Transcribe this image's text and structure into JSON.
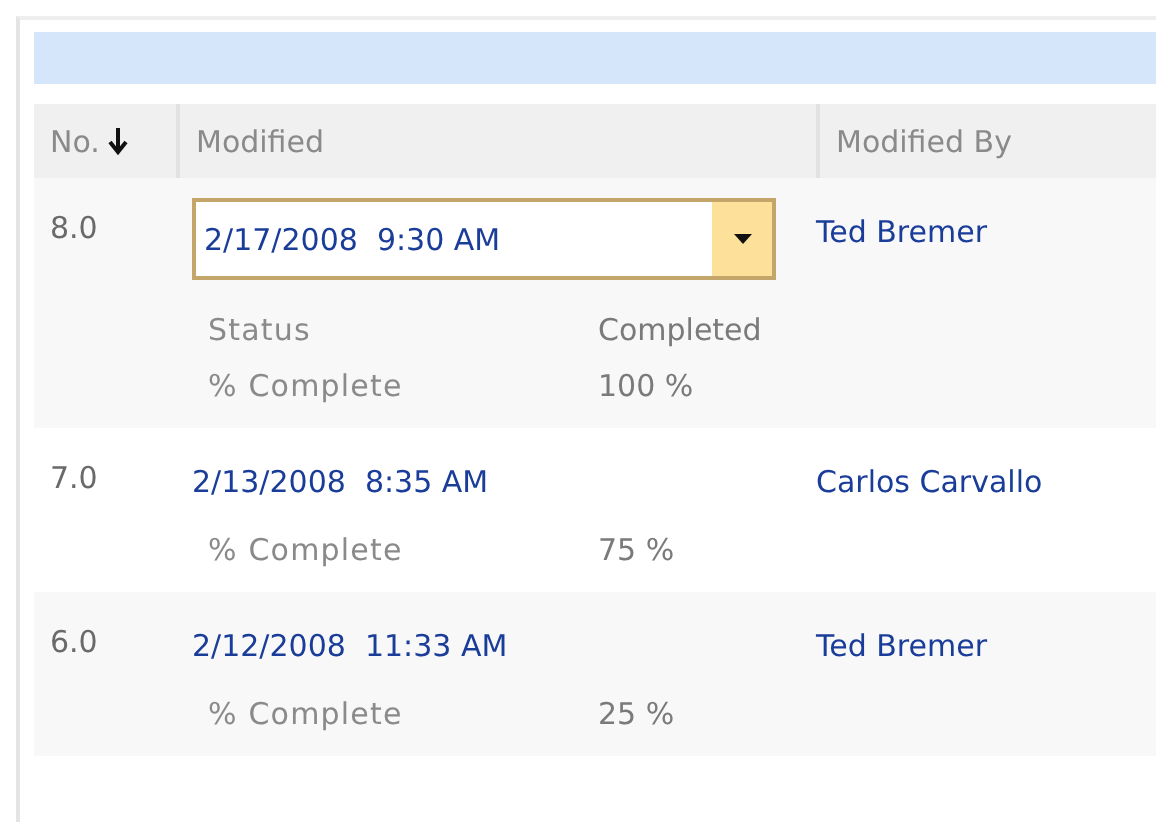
{
  "columns": [
    {
      "label": "No.",
      "sorted": true
    },
    {
      "label": "Modified",
      "sorted": false
    },
    {
      "label": "Modified By",
      "sorted": false
    }
  ],
  "rows": [
    {
      "no": "8.0",
      "modified": "2/17/2008  9:30 AM",
      "modified_by": "Ted Bremer",
      "editing": true,
      "details": [
        {
          "label": "Status",
          "value": "Completed"
        },
        {
          "label": "% Complete",
          "value": "100 %"
        }
      ]
    },
    {
      "no": "7.0",
      "modified": "2/13/2008  8:35 AM",
      "modified_by": "Carlos Carvallo",
      "editing": false,
      "details": [
        {
          "label": "% Complete",
          "value": "75 %"
        }
      ]
    },
    {
      "no": "6.0",
      "modified": "2/12/2008  11:33 AM",
      "modified_by": "Ted Bremer",
      "editing": false,
      "details": [
        {
          "label": "% Complete",
          "value": "25 %"
        }
      ]
    }
  ]
}
